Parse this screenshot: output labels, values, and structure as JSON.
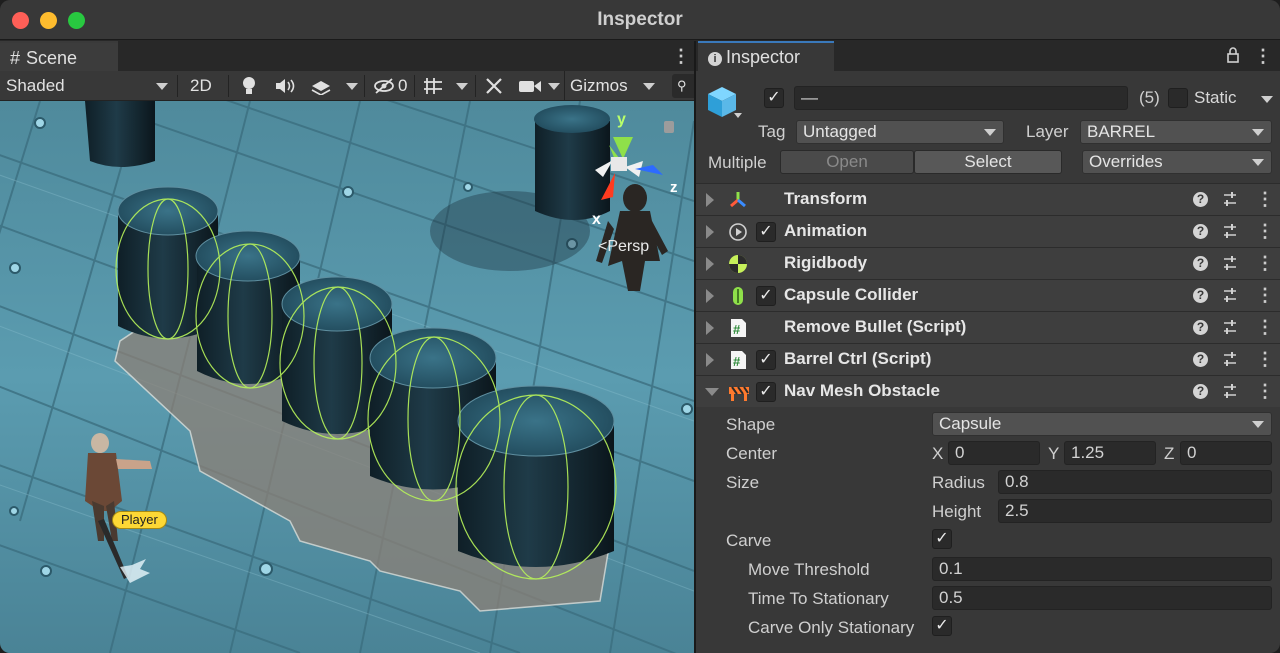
{
  "window": {
    "title": "Inspector"
  },
  "scene": {
    "tab_label": "Scene",
    "toolbar": {
      "draw_mode": "Shaded",
      "mode_2d": "2D",
      "hidden_count": "0",
      "gizmos_label": "Gizmos"
    },
    "gizmo": {
      "y": "y",
      "x": "x",
      "z": "z",
      "projection": "Persp"
    },
    "player_label": "Player"
  },
  "inspector": {
    "tab_label": "Inspector",
    "object": {
      "active": true,
      "name": "—",
      "count": "(5)",
      "static_label": "Static",
      "static": false,
      "tag_label": "Tag",
      "tag_value": "Untagged",
      "layer_label": "Layer",
      "layer_value": "BARREL",
      "multiple_label": "Multiple",
      "open_label": "Open",
      "select_label": "Select",
      "overrides_label": "Overrides"
    },
    "components": [
      {
        "name": "Transform",
        "icon": "transform-icon",
        "checkbox": false
      },
      {
        "name": "Animation",
        "icon": "animation-icon",
        "checkbox": true
      },
      {
        "name": "Rigidbody",
        "icon": "rigidbody-icon",
        "checkbox": false
      },
      {
        "name": "Capsule Collider",
        "icon": "capsule-collider-icon",
        "checkbox": true
      },
      {
        "name": "Remove Bullet (Script)",
        "icon": "script-icon",
        "checkbox": false
      },
      {
        "name": "Barrel Ctrl (Script)",
        "icon": "script-icon",
        "checkbox": true
      },
      {
        "name": "Nav Mesh Obstacle",
        "icon": "nav-mesh-obstacle-icon",
        "checkbox": true
      }
    ],
    "nav_mesh_obstacle": {
      "shape_label": "Shape",
      "shape_value": "Capsule",
      "center_label": "Center",
      "center_x_label": "X",
      "center_x": "0",
      "center_y_label": "Y",
      "center_y": "1.25",
      "center_z_label": "Z",
      "center_z": "0",
      "size_label": "Size",
      "radius_label": "Radius",
      "radius": "0.8",
      "height_label": "Height",
      "height": "2.5",
      "carve_label": "Carve",
      "carve": true,
      "move_threshold_label": "Move Threshold",
      "move_threshold": "0.1",
      "time_to_stationary_label": "Time To Stationary",
      "time_to_stationary": "0.5",
      "carve_only_stationary_label": "Carve Only Stationary",
      "carve_only_stationary": true
    }
  }
}
